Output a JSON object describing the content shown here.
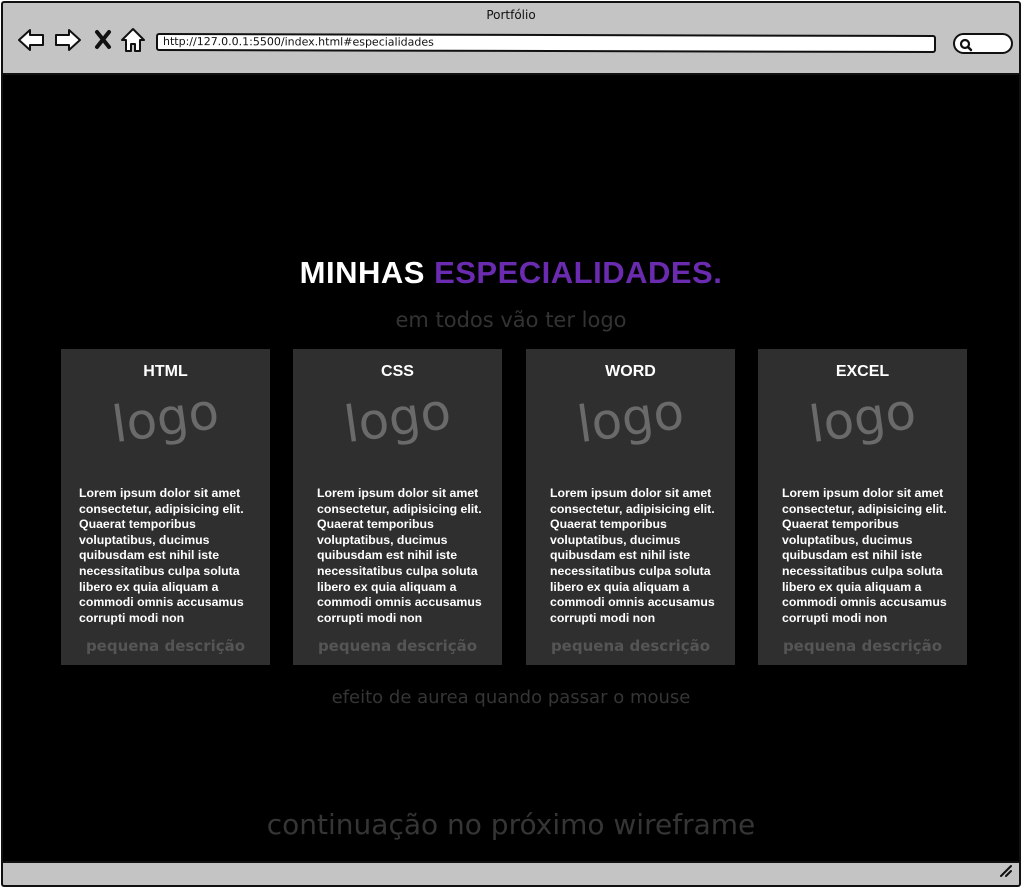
{
  "browser": {
    "window_title": "Portfólio",
    "url": "http://127.0.0.1:5500/index.html#especialidades",
    "icons": [
      "back-arrow-icon",
      "forward-arrow-icon",
      "close-x-icon",
      "home-icon",
      "search-icon",
      "resize-grip-icon"
    ]
  },
  "section": {
    "title_part1": "MINHAS",
    "title_part2": "ESPECIALIDADES.",
    "subtitle": "em todos vão ter logo"
  },
  "cards": [
    {
      "title": "HTML",
      "logo": "logo",
      "text": "Lorem ipsum dolor sit amet consectetur, adipisicing elit. Quaerat temporibus voluptatibus, ducimus quibusdam est nihil iste necessitatibus culpa soluta libero ex quia aliquam a commodi omnis accusamus corrupti modi non",
      "description": "pequena descrição"
    },
    {
      "title": "CSS",
      "logo": "logo",
      "text": "Lorem ipsum dolor sit amet consectetur, adipisicing elit. Quaerat temporibus voluptatibus, ducimus quibusdam est nihil iste necessitatibus culpa soluta libero ex quia aliquam a commodi omnis accusamus corrupti modi non",
      "description": "pequena descrição"
    },
    {
      "title": "WORD",
      "logo": "logo",
      "text": "Lorem ipsum dolor sit amet consectetur, adipisicing elit. Quaerat temporibus voluptatibus, ducimus quibusdam est nihil iste necessitatibus culpa soluta libero ex quia aliquam a commodi omnis accusamus corrupti modi non",
      "description": "pequena descrição"
    },
    {
      "title": "EXCEL",
      "logo": "logo",
      "text": "Lorem ipsum dolor sit amet consectetur, adipisicing elit. Quaerat temporibus voluptatibus, ducimus quibusdam est nihil iste necessitatibus culpa soluta libero ex quia aliquam a commodi omnis accusamus corrupti modi non",
      "description": "pequena descrição"
    }
  ],
  "notes": {
    "hover": "efeito de aurea quando passar o mouse",
    "continuation": "continuação no próximo wireframe"
  },
  "colors": {
    "accent_purple": "#6a2bb0",
    "page_background": "#000000",
    "card_background": "#2f2f2f",
    "chrome_gray": "#c4c4c4"
  }
}
